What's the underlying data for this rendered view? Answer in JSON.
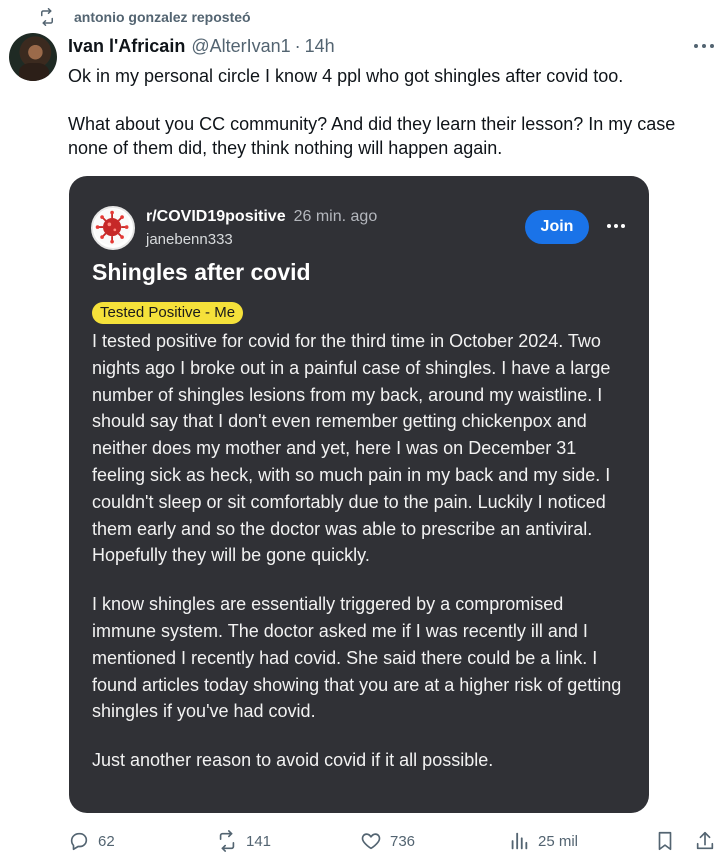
{
  "repost": {
    "text": "antonio gonzalez reposteó",
    "icon": "repost-icon"
  },
  "author": {
    "name": "Ivan l'Africain",
    "handle": "@AlterIvan1",
    "separator": "·",
    "time": "14h"
  },
  "tweet": {
    "paragraphs": [
      "Ok in my personal circle I know 4 ppl who got shingles after covid too.",
      "What about you CC community? And did they learn their lesson? In my case none of them did, they think nothing will happen again."
    ]
  },
  "embed": {
    "subreddit": "r/COVID19positive",
    "time": "26 min. ago",
    "user": "janebenn333",
    "join_label": "Join",
    "title": "Shingles after covid",
    "flair": "Tested Positive - Me",
    "body": [
      "I tested positive for covid for the third time in October 2024. Two nights ago I broke out in a painful case of shingles. I have a large number of shingles lesions from my back, around my waistline. I should say that I don't even remember getting chickenpox and neither does my mother and yet, here I was on December 31 feeling sick as heck, with so much pain in my back and my side. I couldn't sleep or sit comfortably due to the pain. Luckily I noticed them early and so the doctor was able to prescribe an antiviral. Hopefully they will be gone quickly.",
      "I know shingles are essentially triggered by a compromised immune system. The doctor asked me if I was recently ill and I mentioned I recently had covid. She said there could be a link. I found articles today showing that you are at a higher risk of getting shingles if you've had covid.",
      "Just another reason to avoid covid if it all possible."
    ]
  },
  "actions": {
    "replies": "62",
    "reposts": "141",
    "likes": "736",
    "views": "25 mil"
  },
  "colors": {
    "join": "#1a73e8",
    "flair": "#f5e13a",
    "card_bg": "#303136",
    "muted": "#536471"
  }
}
